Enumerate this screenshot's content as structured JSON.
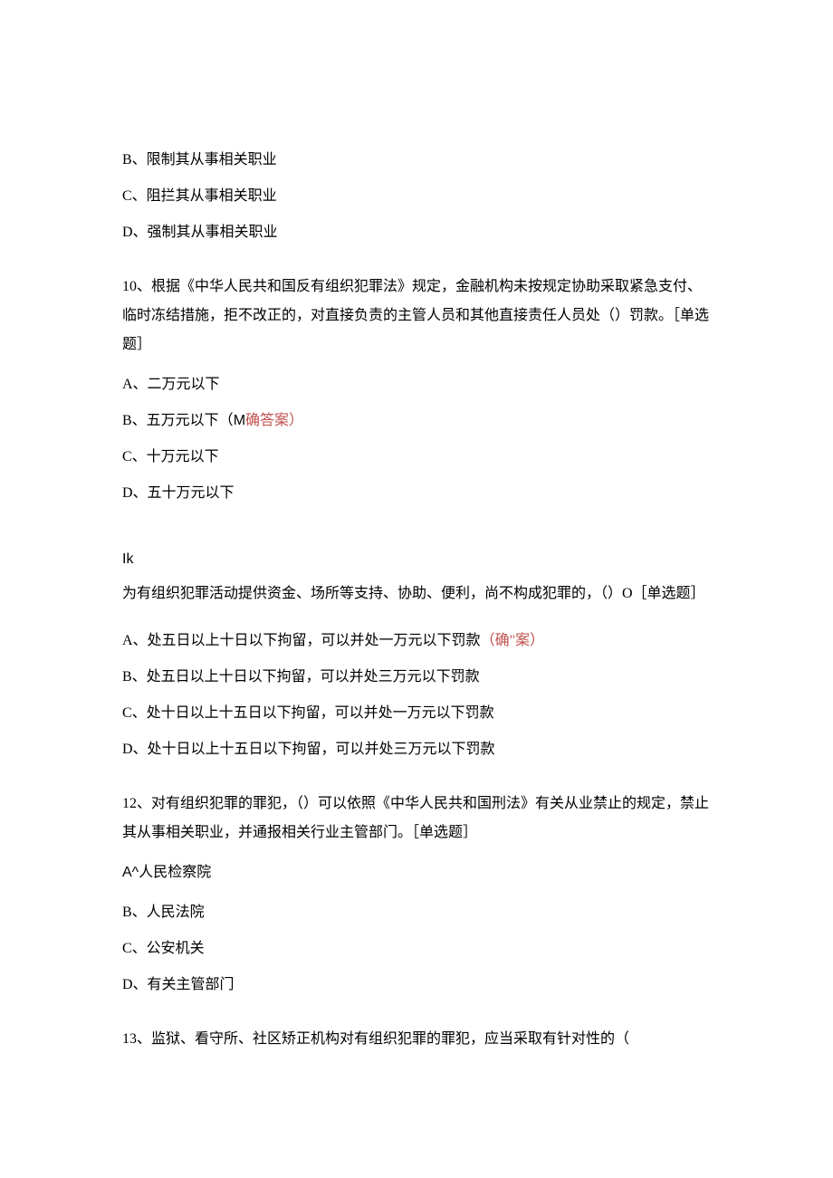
{
  "orphan_options": {
    "b": "B、限制其从事相关职业",
    "c": "C、阻拦其从事相关职业",
    "d": "D、强制其从事相关职业"
  },
  "q10": {
    "stem": "10、根据《中华人民共和国反有组织犯罪法》规定，金融机构未按规定协助采取紧急支付、临时冻结措施，拒不改正的，对直接负责的主管人员和其他直接责任人员处（）罚款。［单选题］",
    "a": "A、二万元以下",
    "b_pre": "B、五万元以下（",
    "b_m": "M",
    "b_ans": "确答案）",
    "c": "C、十万元以下",
    "d": "D、五十万元以下"
  },
  "q11": {
    "stem_pre": "Ik",
    "stem_rest": "为有组织犯罪活动提供资金、场所等支持、协助、便利，尚不构成犯罪的，（）O［单选题］",
    "a_text": "A、处五日以上十日以下拘留，可以并处一万元以下罚款",
    "a_ans": "（确\"案）",
    "b": "B、处五日以上十日以下拘留，可以并处三万元以下罚款",
    "c": "C、处十日以上十五日以下拘留，可以并处一万元以下罚款",
    "d": "D、处十日以上十五日以下拘留，可以并处三万元以下罚款"
  },
  "q12": {
    "stem": "12、对有组织犯罪的罪犯，（）可以依照《中华人民共和国刑法》有关从业禁止的规定，禁止其从事相关职业，并通报相关行业主管部门。［单选题］",
    "a_pre": "A^",
    "a_rest": "人民检察院",
    "b": "B、人民法院",
    "c": "C、公安机关",
    "d": "D、有关主管部门"
  },
  "q13": {
    "stem": "13、监狱、看守所、社区矫正机构对有组织犯罪的罪犯，应当采取有针对性的（"
  }
}
